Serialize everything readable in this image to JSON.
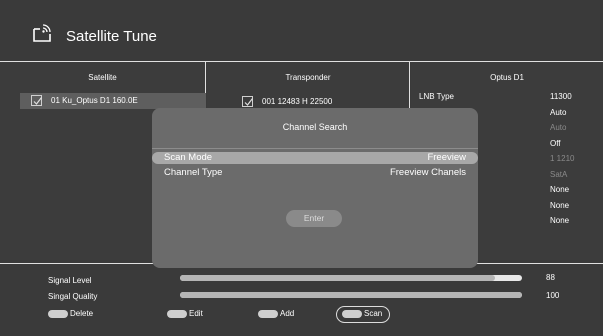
{
  "header": {
    "title": "Satellite Tune"
  },
  "satellite": {
    "heading": "Satellite",
    "item": "01 Ku_Optus D1 160.0E"
  },
  "transponder": {
    "heading": "Transponder",
    "item": "001  12483 H 22500"
  },
  "details": {
    "heading": "Optus D1",
    "lnb_label": "LNB Type",
    "values": [
      "11300",
      "Auto",
      "Auto",
      "Off",
      "1 1210",
      "SatA",
      "None",
      "None",
      "None"
    ]
  },
  "dialog": {
    "title": "Channel Search",
    "rows": [
      {
        "label": "Scan Mode",
        "value": "Freeview"
      },
      {
        "label": "Channel Type",
        "value": "Freeview Chanels"
      }
    ],
    "enter_label": "Enter"
  },
  "signal": {
    "level_label": "Signal Level",
    "level_value": "88",
    "level_fraction": 0.92,
    "quality_label": "Singal Quality",
    "quality_value": "100",
    "quality_fraction": 1.0
  },
  "keys": {
    "delete": "Delete",
    "edit": "Edit",
    "add": "Add",
    "scan": "Scan"
  }
}
